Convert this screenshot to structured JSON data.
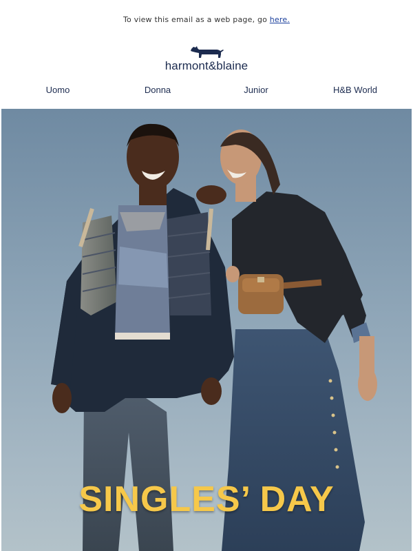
{
  "preheader": {
    "text": "To view this email as a web page, go ",
    "link_label": "here."
  },
  "brand": {
    "logo_icon": "dachshund-icon",
    "name": "harmont&blaine"
  },
  "nav": {
    "items": [
      {
        "label": "Uomo"
      },
      {
        "label": "Donna"
      },
      {
        "label": "Junior"
      },
      {
        "label": "H&B World"
      }
    ]
  },
  "hero": {
    "image": "couple-in-winter-jackets-photo",
    "headline": "SINGLES’ DAY"
  },
  "colors": {
    "brand_navy": "#1c2b4f",
    "link_blue": "#1a3f9c",
    "headline_yellow": "#f6c84a"
  }
}
